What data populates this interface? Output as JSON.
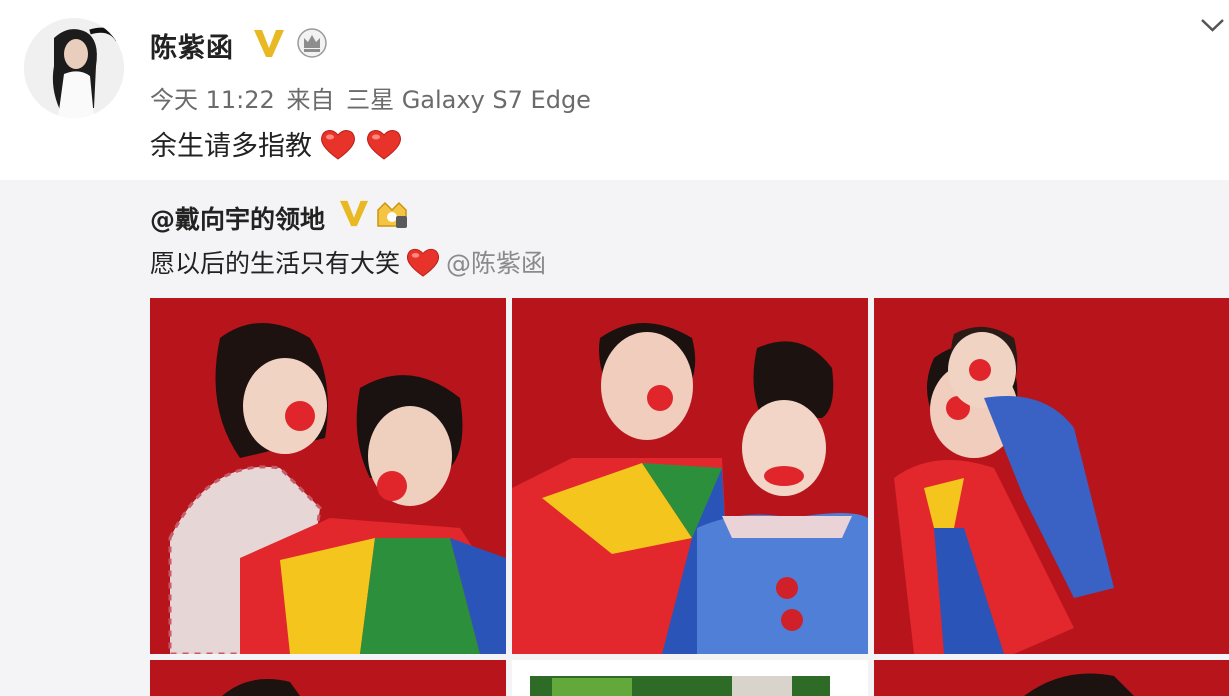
{
  "post": {
    "author": "陈紫函",
    "time": "今天 11:22",
    "source_prefix": "来自",
    "source_device": "三星 Galaxy S7 Edge",
    "text": "余生请多指教"
  },
  "repost": {
    "author": "@戴向宇的领地",
    "text": "愿以后的生活只有大笑",
    "mention": "@陈紫函"
  },
  "icons": {
    "verified": "verified-v-icon",
    "crown": "crown-badge-icon",
    "expand": "chevron-down-icon",
    "heart": "heart-emoji-icon"
  },
  "colors": {
    "verified_gold": "#e8b923",
    "heart_red": "#e8332b",
    "photo_background": "#b8141c",
    "repost_background": "#f4f4f6"
  }
}
